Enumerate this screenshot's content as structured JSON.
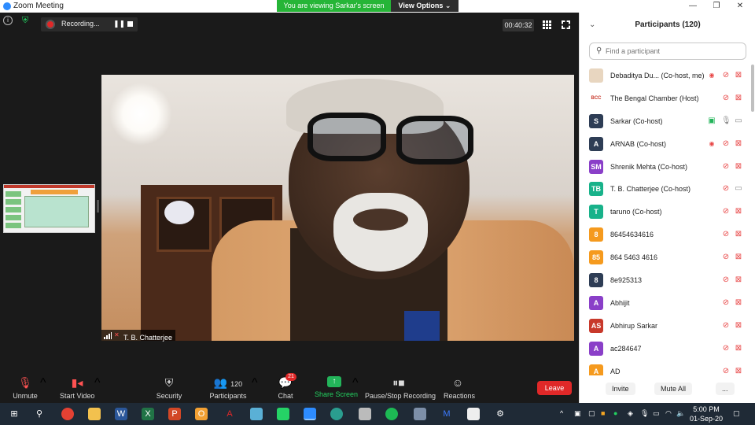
{
  "window": {
    "title": "Zoom Meeting",
    "viewing_banner": "You are viewing Sarkar's screen",
    "view_options": "View Options ⌄",
    "minimize": "—",
    "restore": "❐",
    "close": "✕"
  },
  "meeting": {
    "recording_label": "Recording...",
    "pause_symbol": "❚❚",
    "timer": "00:40:32",
    "speaker_name": "T. B. Chatterjee"
  },
  "toolbar": {
    "unmute": "Unmute",
    "start_video": "Start Video",
    "security": "Security",
    "participants": "Participants",
    "participants_count": "120",
    "chat": "Chat",
    "chat_badge": "21",
    "share_screen": "Share Screen",
    "record": "Pause/Stop Recording",
    "reactions": "Reactions",
    "leave": "Leave"
  },
  "panel": {
    "title": "Participants (120)",
    "search_placeholder": "Find a participant",
    "participants": [
      {
        "name": "Debaditya Du... (Co-host, me)",
        "initials": "",
        "color": "#e8d6c0",
        "mic": "muted",
        "cam": "off"
      },
      {
        "name": "The Bengal Chamber (Host)",
        "initials": "BCC",
        "color": "#ffffff",
        "mic": "muted",
        "cam": "off"
      },
      {
        "name": "Sarkar (Co-host)",
        "initials": "S",
        "color": "#2e3d55",
        "mic": "on",
        "cam": "on"
      },
      {
        "name": "ARNAB (Co-host)",
        "initials": "A",
        "color": "#2e3d55",
        "mic": "muted",
        "cam": "off"
      },
      {
        "name": "Shrenik Mehta (Co-host)",
        "initials": "SM",
        "color": "#8a3fc8",
        "mic": "muted",
        "cam": "off"
      },
      {
        "name": "T. B. Chatterjee (Co-host)",
        "initials": "TB",
        "color": "#18b28a",
        "mic": "muted",
        "cam": "on"
      },
      {
        "name": "taruno (Co-host)",
        "initials": "T",
        "color": "#18b28a",
        "mic": "muted",
        "cam": "off"
      },
      {
        "name": " 86454634616",
        "initials": "8",
        "color": "#f59a1e",
        "mic": "muted",
        "cam": "off"
      },
      {
        "name": "864 5463 4616",
        "initials": "85",
        "color": "#f59a1e",
        "mic": "muted",
        "cam": "off"
      },
      {
        "name": "8e925313",
        "initials": "8",
        "color": "#2e3d55",
        "mic": "muted",
        "cam": "off"
      },
      {
        "name": "Abhijit",
        "initials": "A",
        "color": "#8a3fc8",
        "mic": "muted",
        "cam": "off"
      },
      {
        "name": "Abhirup Sarkar",
        "initials": "AS",
        "color": "#c8392b",
        "mic": "muted",
        "cam": "off"
      },
      {
        "name": "ac284647",
        "initials": "A",
        "color": "#8a3fc8",
        "mic": "muted",
        "cam": "off"
      },
      {
        "name": "AD",
        "initials": "A",
        "color": "#f59a1e",
        "mic": "muted",
        "cam": "off"
      }
    ],
    "invite": "Invite",
    "mute_all": "Mute All",
    "more": "..."
  },
  "taskbar": {
    "time": "5:00 PM",
    "date": "01-Sep-20"
  }
}
